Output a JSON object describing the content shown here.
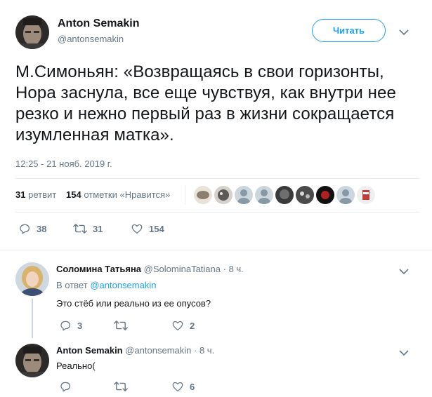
{
  "main_tweet": {
    "author_name": "Anton Semakin",
    "author_handle": "@antonsemakin",
    "follow_label": "Читать",
    "text": "М.Симоньян: «Возвращаясь в свои горизонты, Нора заснула, все еще чувствуя, как внутри нее резко и нежно первый раз в жизни сокращается изумленная матка».",
    "timestamp": "12:25 - 21 нояб. 2019 г.",
    "retweets_count": "31",
    "retweets_label": "ретвит",
    "likes_count": "154",
    "likes_label": "отметки «Нравится»",
    "actions": {
      "replies": "38",
      "retweets": "31",
      "likes": "154"
    }
  },
  "replies": [
    {
      "name": "Соломина Татьяна",
      "handle": "@SolominaTatiana",
      "time": "· 8 ч.",
      "in_reply_prefix": "В ответ",
      "in_reply_to": "@antonsemakin",
      "text": "Это стёб или реально из ее опусов?",
      "actions": {
        "replies": "3",
        "retweets": "",
        "likes": "2"
      }
    },
    {
      "name": "Anton Semakin",
      "handle": "@antonsemakin",
      "time": "· 8 ч.",
      "text": "Реально(",
      "actions": {
        "replies": "",
        "retweets": "",
        "likes": "6"
      }
    }
  ],
  "colors": {
    "accent": "#1da1f2",
    "secondary": "#657786",
    "text": "#14171a",
    "divider": "#e6ecf0"
  },
  "icons": [
    "caret-down-icon",
    "reply-icon",
    "retweet-icon",
    "like-icon"
  ]
}
